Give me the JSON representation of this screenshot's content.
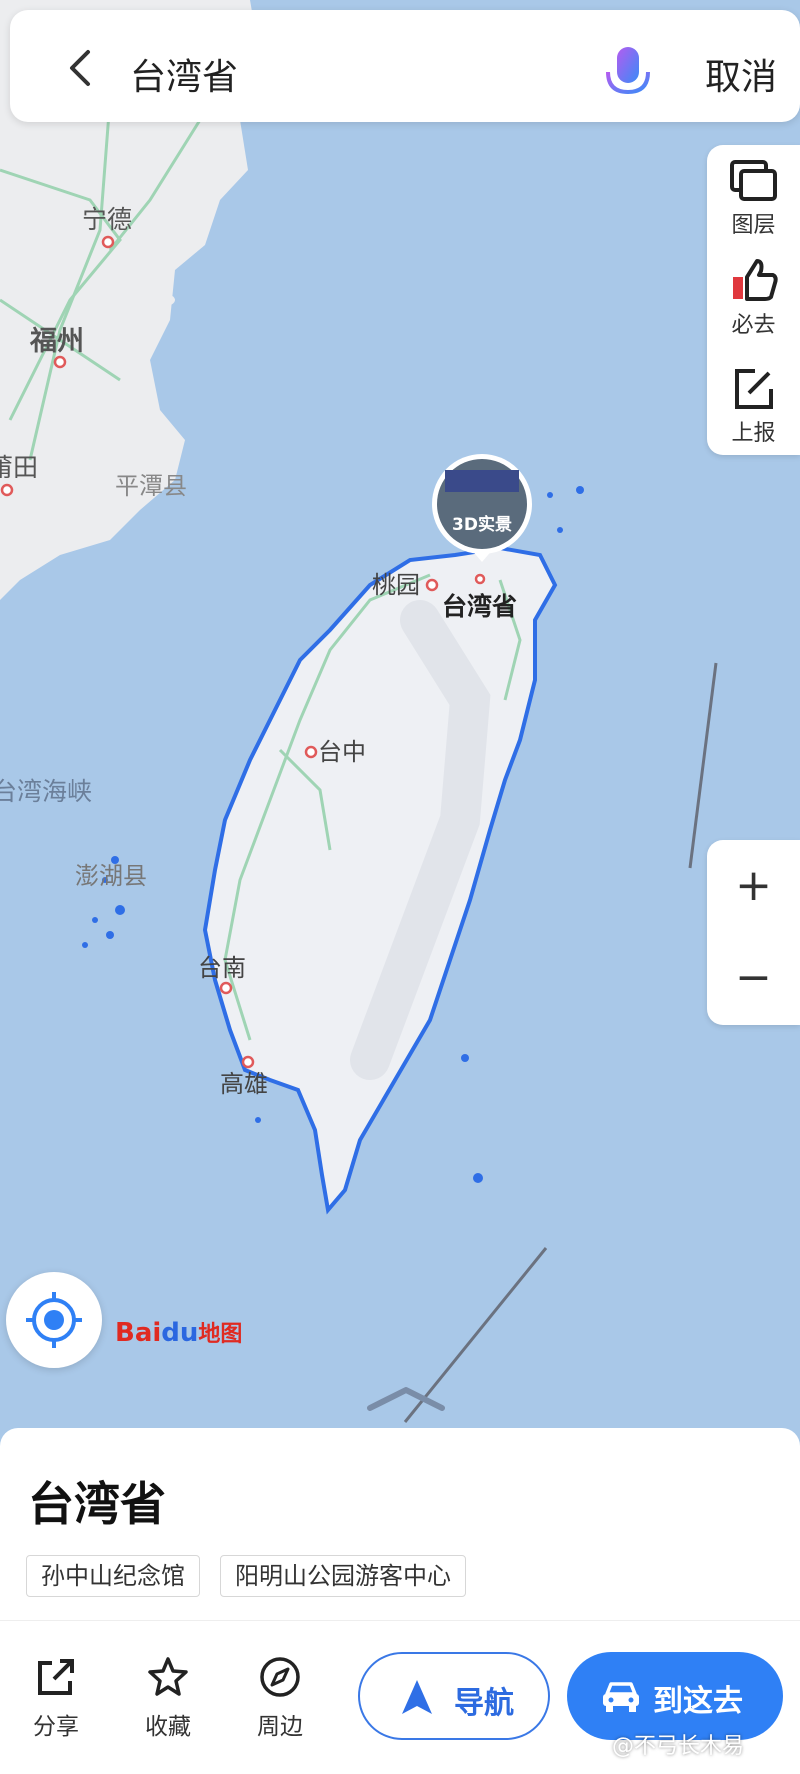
{
  "header": {
    "search_text": "台湾省",
    "cancel_label": "取消"
  },
  "tools": {
    "layers_label": "图层",
    "must_go_label": "必去",
    "report_label": "上报"
  },
  "zoom": {
    "in_label": "+",
    "out_label": "−"
  },
  "map": {
    "labels": {
      "ningde": "宁德",
      "fuzhou": "福州",
      "putian": "莆田",
      "pingtan": "平潭县",
      "strait": "台湾海峡",
      "penghu": "澎湖县",
      "taoyuan": "桃园",
      "taiwan": "台湾省",
      "taizhong": "台中",
      "tainan": "台南",
      "gaoxiong": "高雄"
    },
    "badge_3d": "3D实景"
  },
  "logo": {
    "bai": "Bai",
    "du": "du",
    "ditu": "地图"
  },
  "place": {
    "title": "台湾省",
    "tags": [
      "孙中山纪念馆",
      "阳明山公园游客中心"
    ]
  },
  "actions": {
    "share": "分享",
    "favorite": "收藏",
    "nearby": "周边",
    "navigate": "导航",
    "go_here": "到这去"
  },
  "watermark": "@不弓长木易",
  "colors": {
    "accent": "#2f80f5",
    "sea": "#a9c8e8",
    "land": "#eef0f4",
    "coast": "#2f6ee6"
  }
}
